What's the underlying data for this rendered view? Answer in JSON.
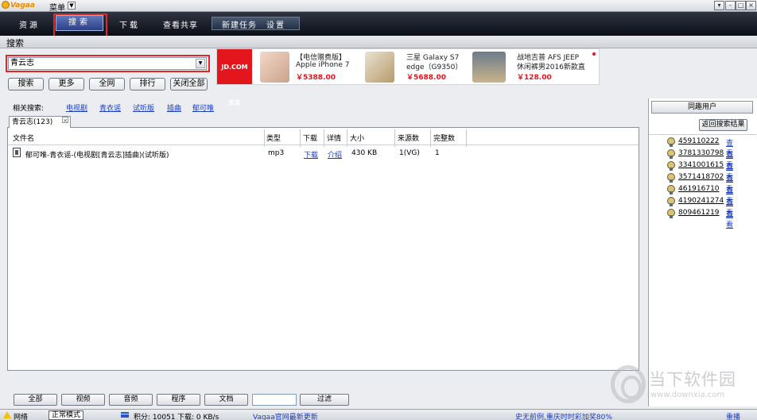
{
  "app": {
    "logo_text": "Vagaa",
    "menu_label": "菜单"
  },
  "nav": {
    "tabs": [
      "资源",
      "搜索",
      "下载",
      "查看共享"
    ],
    "active_tab": "搜索",
    "group": [
      "新建任务",
      "设置"
    ]
  },
  "page": {
    "title": "搜索"
  },
  "search": {
    "query": "青云志",
    "buttons": [
      "搜索",
      "更多",
      "全网",
      "排行",
      "关闭全部"
    ]
  },
  "ad": {
    "brand": "JD.COM 京东",
    "items": [
      {
        "line1": "【电信赠费版】",
        "line2": "Apple iPhone 7",
        "price": "￥5388.00"
      },
      {
        "line1": "三星 Galaxy S7",
        "line2": "edge（G9350）",
        "price": "￥5688.00"
      },
      {
        "line1": "战地吉普 AFS JEEP",
        "line2": "休闲裤男2016新款直",
        "price": "￥128.00"
      }
    ]
  },
  "related": {
    "label": "相关搜索:",
    "links": [
      "电视剧",
      "青衣谣",
      "试听版",
      "插曲",
      "郁可唯"
    ]
  },
  "results": {
    "tab_label": "青云志(123)",
    "columns": [
      "文件名",
      "类型",
      "下载",
      "详情",
      "大小",
      "来源数",
      "完整数"
    ],
    "rows": [
      {
        "name": "郁可唯-青衣谣-(电视剧[青云志]插曲)(试听版)",
        "type": "mp3",
        "download": "下载",
        "detail": "介绍",
        "size": "430 KB",
        "sources": "1(VG)",
        "complete": "1"
      }
    ]
  },
  "filters": {
    "buttons": [
      "全部",
      "视频",
      "音频",
      "程序",
      "文档"
    ],
    "input_value": "",
    "apply": "过滤"
  },
  "right_panel": {
    "header": "同趣用户",
    "back_button": "返回搜索结果",
    "view_label": "查看",
    "users": [
      "459110222",
      "3781330798",
      "3341001615",
      "3571418702",
      "461916710",
      "4190241274",
      "809461219"
    ]
  },
  "status": {
    "network": "网络",
    "mode": "正常模式",
    "points": "积分: 10051",
    "download_speed": "下载: 0 KB/s",
    "news_link": "Vagaa官网最新更新",
    "promo_link": "史无前例,重庆时时彩加奖80%",
    "restart": "重播"
  },
  "watermark": {
    "cn": "当下软件园",
    "en": "www.downxia.com"
  },
  "colors": {
    "nav_bg": "#0c0f17",
    "link": "#1a3dbf",
    "highlight": "#e32626",
    "price": "#e4161d"
  }
}
